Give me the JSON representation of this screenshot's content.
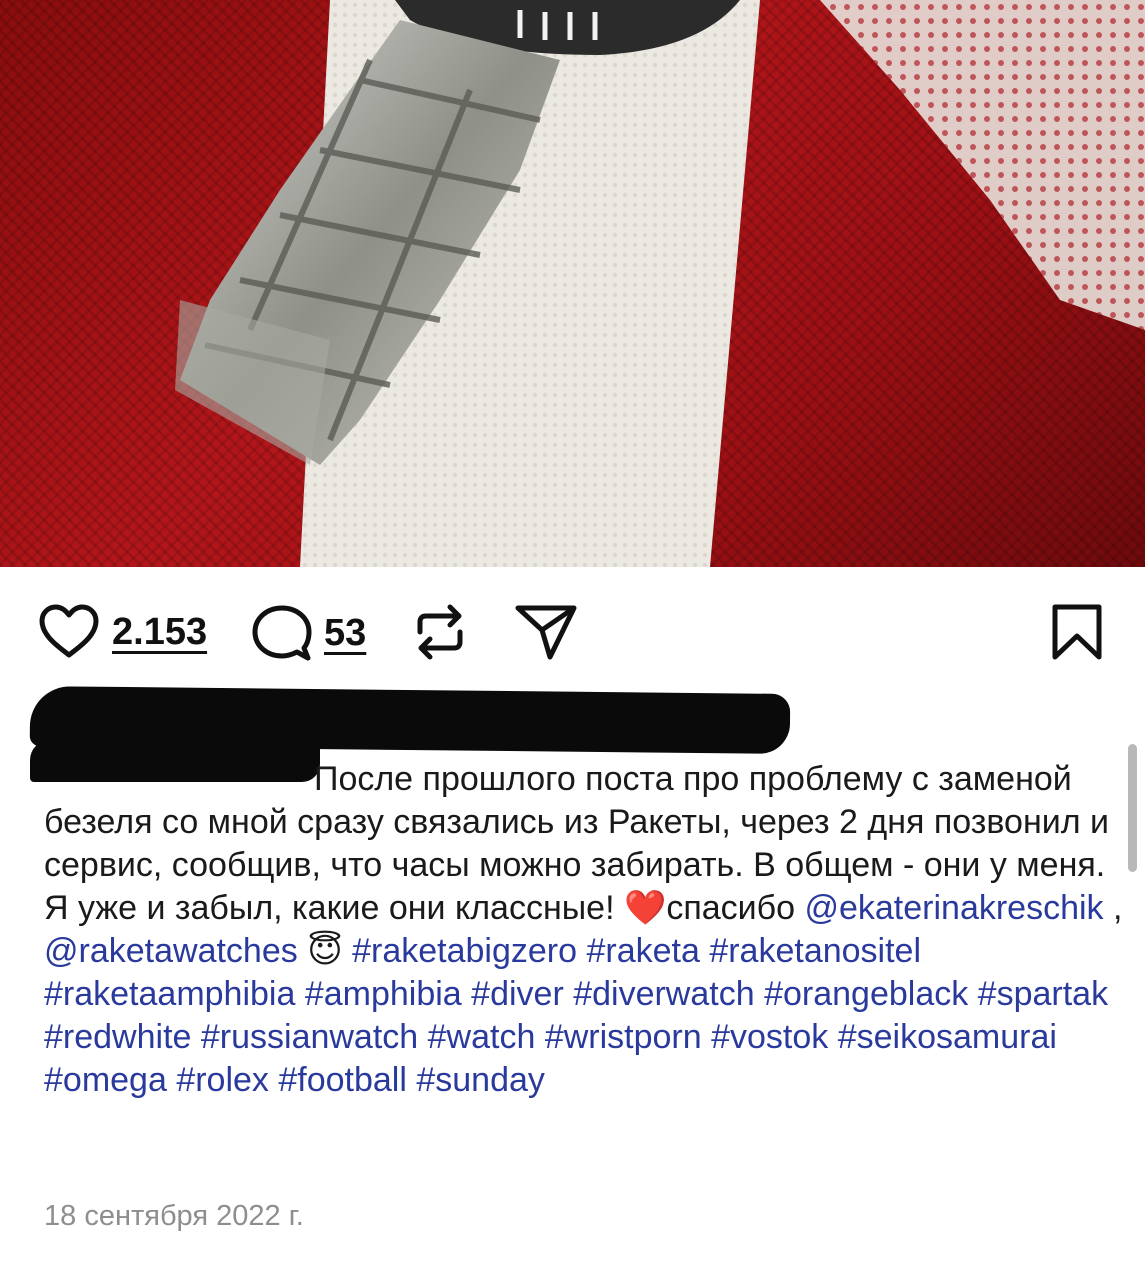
{
  "post": {
    "likes": "2.153",
    "comments": "53",
    "caption_text": "После прошлого поста про проблему с заменой безеля со мной сразу связались из Ракеты, через 2 дня позвонил и сервис, сообщив, что часы можно забирать. В общем - они у меня. Я уже и забыл, какие они классные! ",
    "heart_emoji": "❤️",
    "thanks": "спасибо ",
    "mention_1": "@ekaterinakreschik",
    "separator": " ,",
    "mention_2": "@raketawatches",
    "angel_emoji": "😇",
    "hashtags": "#raketabigzero #raketa #raketanositel #raketaamphibia #amphibia #diver #diverwatch #orangeblack #spartak #redwhite #russianwatch #watch #wristporn #vostok #seikosamurai #omega #rolex #football #sunday",
    "date": "18 сентября 2022 г."
  },
  "icons": {
    "like": "heart-outline-icon",
    "comment": "comment-bubble-icon",
    "repost": "repost-arrows-icon",
    "share": "send-paper-plane-icon",
    "save": "bookmark-icon"
  },
  "colors": {
    "link": "#2a3a9c",
    "date": "#8e8e8e",
    "text": "#1a1a1a"
  }
}
